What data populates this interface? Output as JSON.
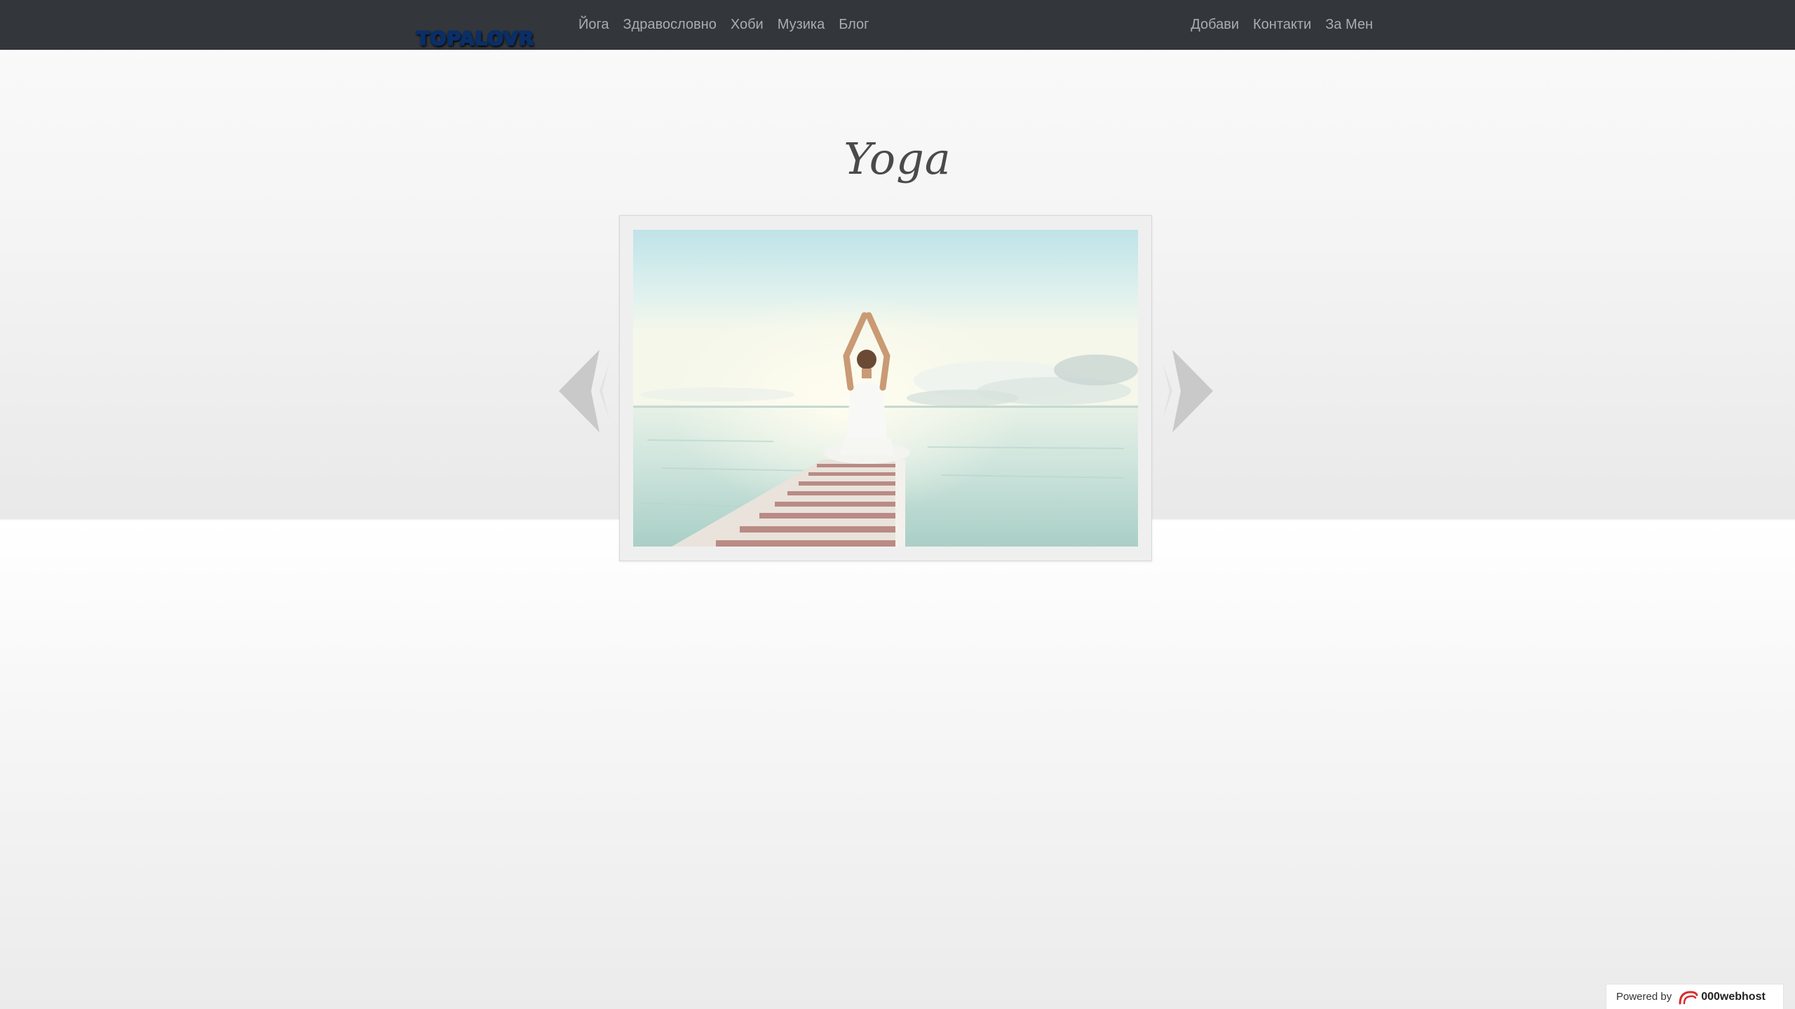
{
  "navbar": {
    "brand": "TOPALOVR",
    "left_items": [
      {
        "label": "Йога"
      },
      {
        "label": "Здравословно"
      },
      {
        "label": "Хоби"
      },
      {
        "label": "Музика"
      },
      {
        "label": "Блог"
      }
    ],
    "right_items": [
      {
        "label": "Добави"
      },
      {
        "label": "Контакти"
      },
      {
        "label": "За Мен"
      }
    ]
  },
  "page": {
    "title": "Yoga"
  },
  "slider": {
    "prev_icon": "chevron-left-icon",
    "next_icon": "chevron-right-icon"
  },
  "footer": {
    "powered_label": "Powered by",
    "powered_brand": "000webhost"
  },
  "colors": {
    "navbar_bg": "#33373c",
    "nav_link": "#a8adb2",
    "title": "#4a4a4a"
  }
}
